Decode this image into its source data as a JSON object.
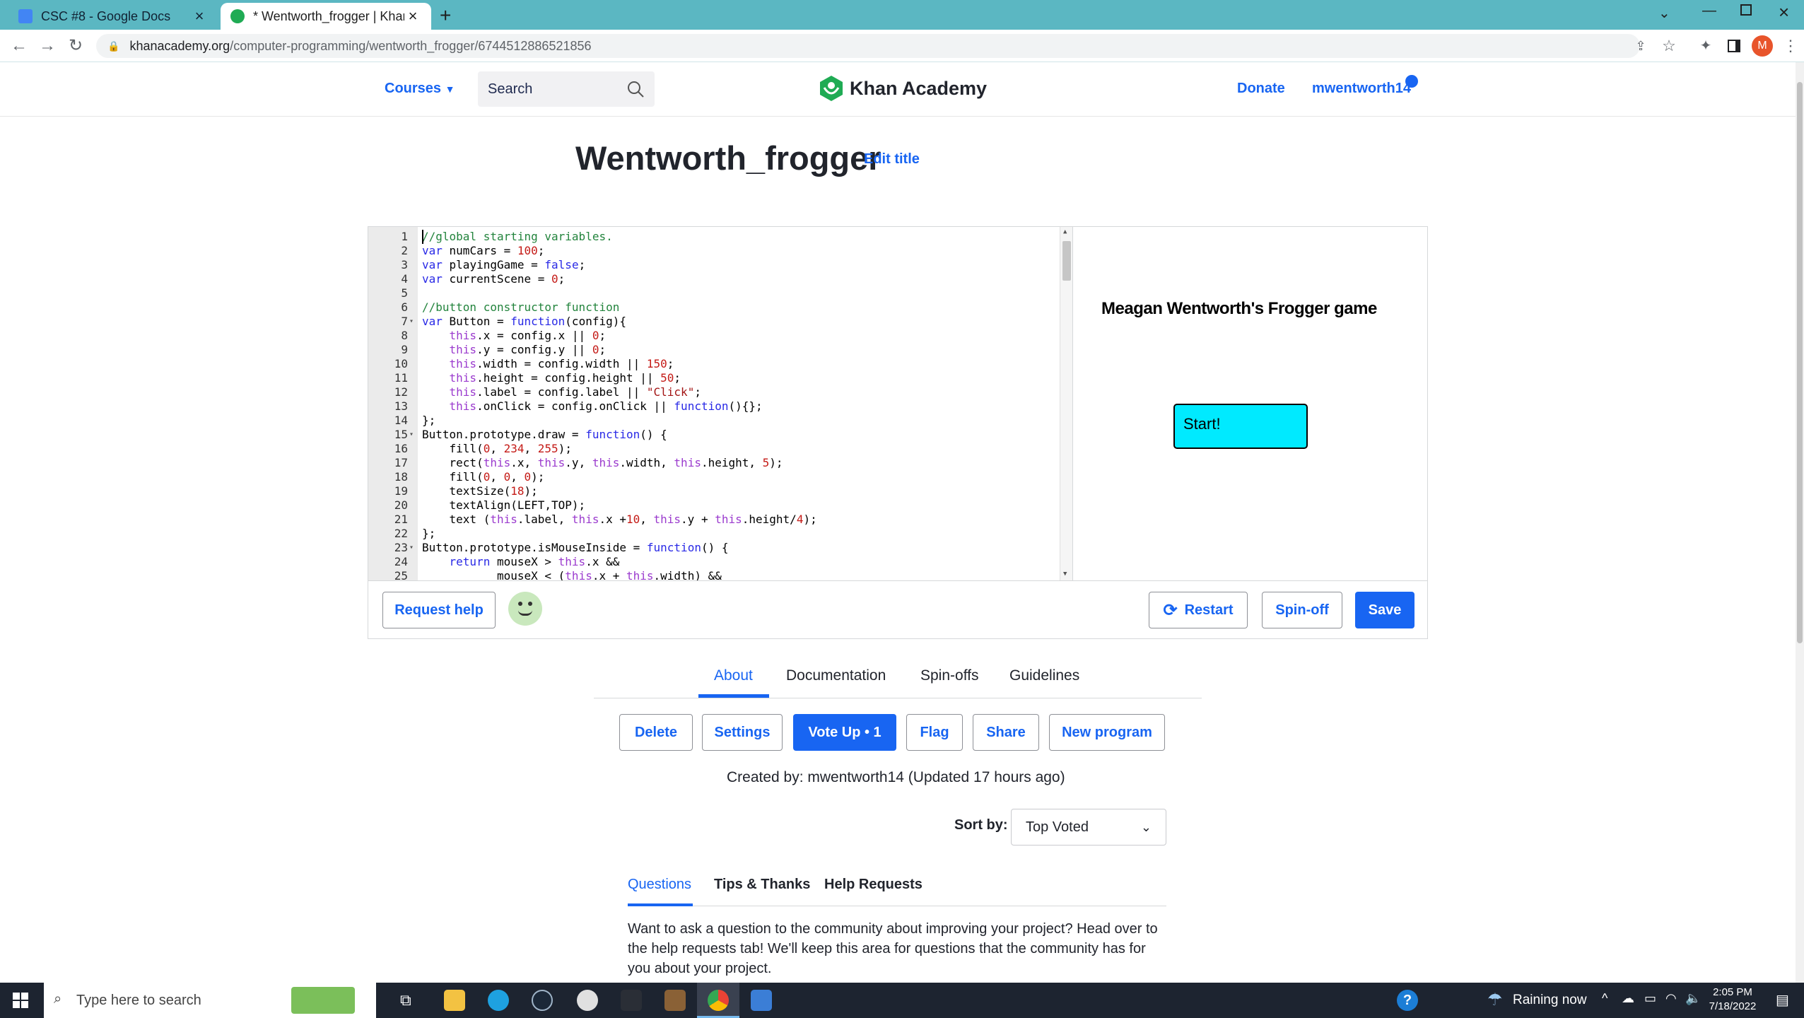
{
  "browser": {
    "tabs": [
      {
        "title": "CSC #8 - Google Docs",
        "active": false
      },
      {
        "title": "* Wentworth_frogger | Khan Acad",
        "active": true
      }
    ],
    "url_host": "khanacademy.org",
    "url_path": "/computer-programming/wentworth_frogger/6744512886521856",
    "profile_initial": "M"
  },
  "header": {
    "courses": "Courses",
    "search_placeholder": "Search",
    "logo": "Khan Academy",
    "donate": "Donate",
    "username": "mwentworth14"
  },
  "program": {
    "title": "Wentworth_frogger",
    "edit_title": "Edit title"
  },
  "code": {
    "lines": [
      "//global starting variables.",
      "var numCars = 100;",
      "var playingGame = false;",
      "var currentScene = 0;",
      "",
      "//button constructor function",
      "var Button = function(config){",
      "    this.x = config.x || 0;",
      "    this.y = config.y || 0;",
      "    this.width = config.width || 150;",
      "    this.height = config.height || 50;",
      "    this.label = config.label || \"Click\";",
      "    this.onClick = config.onClick || function(){};",
      "};",
      "Button.prototype.draw = function() {",
      "    fill(0, 234, 255);",
      "    rect(this.x, this.y, this.width, this.height, 5);",
      "    fill(0, 0, 0);",
      "    textSize(18);",
      "    textAlign(LEFT,TOP);",
      "    text (this.label, this.x +10, this.y + this.height/4);",
      "};",
      "Button.prototype.isMouseInside = function() {",
      "    return mouseX > this.x &&",
      "           mouseX < (this.x + this.width) &&"
    ]
  },
  "canvas": {
    "game_title": "Meagan Wentworth's Frogger game",
    "start_label": "Start!",
    "start_color": "#00eaff"
  },
  "editor_bar": {
    "request_help": "Request help",
    "restart": "Restart",
    "spinoff": "Spin-off",
    "save": "Save"
  },
  "about_tabs": [
    "About",
    "Documentation",
    "Spin-offs",
    "Guidelines"
  ],
  "actions": {
    "delete": "Delete",
    "settings": "Settings",
    "vote_up": "Vote Up • 1",
    "flag": "Flag",
    "share": "Share",
    "new_program": "New program"
  },
  "created_by": "Created by: mwentworth14 (Updated 17 hours ago)",
  "sort": {
    "label": "Sort by:",
    "value": "Top Voted"
  },
  "question_tabs": [
    "Questions",
    "Tips & Thanks",
    "Help Requests"
  ],
  "questions_text": "Want to ask a question to the community about improving your project? Head over to the help requests tab! We'll keep this area for questions that the community has for you about your project.",
  "taskbar": {
    "search_placeholder": "Type here to search",
    "weather": "Raining now",
    "time": "2:05 PM",
    "date": "7/18/2022"
  },
  "colors": {
    "accent": "#1865f2",
    "tabstrip": "#5bb7c2",
    "ka_green": "#1fab54"
  }
}
